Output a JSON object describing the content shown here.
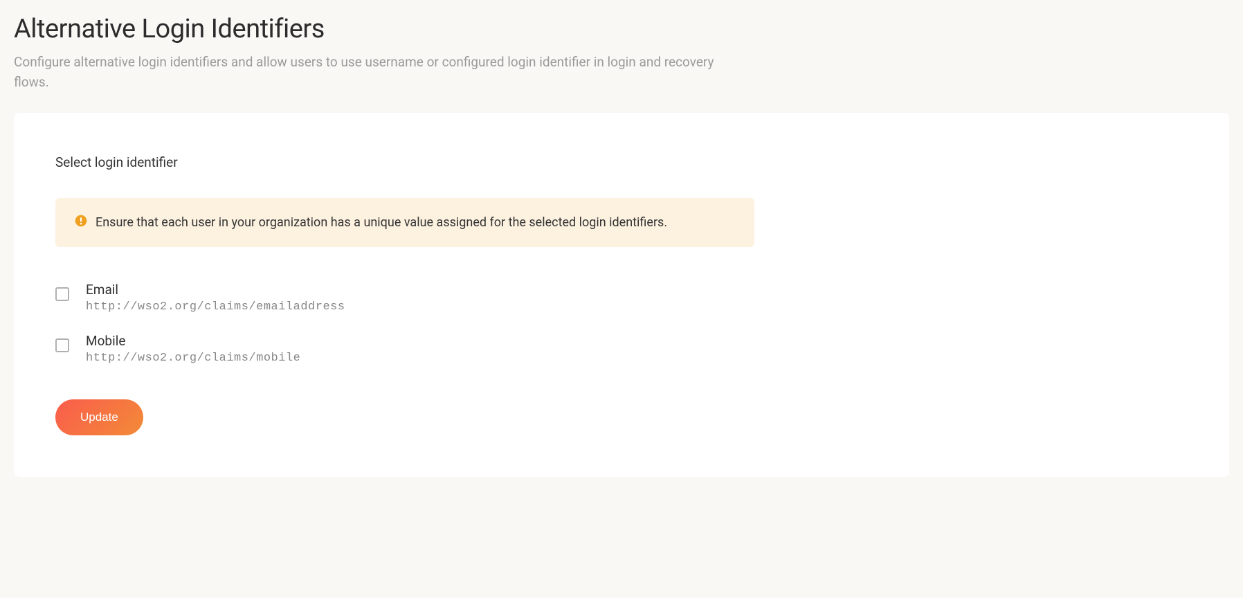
{
  "header": {
    "title": "Alternative Login Identifiers",
    "description": "Configure alternative login identifiers and allow users to use username or configured login identifier in login and recovery flows."
  },
  "form": {
    "section_label": "Select login identifier",
    "info_message": "Ensure that each user in your organization has a unique value assigned for the selected login identifiers.",
    "identifiers": [
      {
        "label": "Email",
        "claim": "http://wso2.org/claims/emailaddress",
        "checked": false
      },
      {
        "label": "Mobile",
        "claim": "http://wso2.org/claims/mobile",
        "checked": false
      }
    ],
    "update_button_label": "Update"
  }
}
